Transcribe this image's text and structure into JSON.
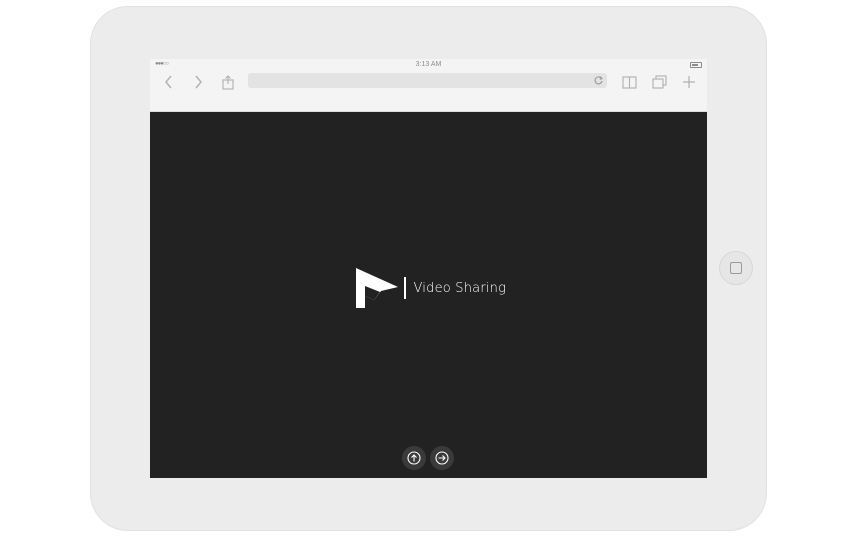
{
  "status_bar": {
    "signal_glyph": "●●●○○",
    "time": "3:13 AM",
    "battery_icon": "battery-icon"
  },
  "toolbar": {
    "back_icon": "chevron-left-icon",
    "forward_icon": "chevron-right-icon",
    "share_icon": "share-icon",
    "url": "",
    "reload_icon": "reload-icon",
    "bookmarks_icon": "book-icon",
    "tabs_icon": "tabs-icon",
    "new_tab_icon": "plus-icon"
  },
  "page": {
    "brand_name": "Video Sharing",
    "logo_icon": "play-logo-icon",
    "upload_icon": "upload-icon",
    "signin_icon": "sign-in-icon"
  },
  "colors": {
    "screen_bg": "#222222",
    "text": "#ffffff",
    "bezel": "#ececec"
  }
}
